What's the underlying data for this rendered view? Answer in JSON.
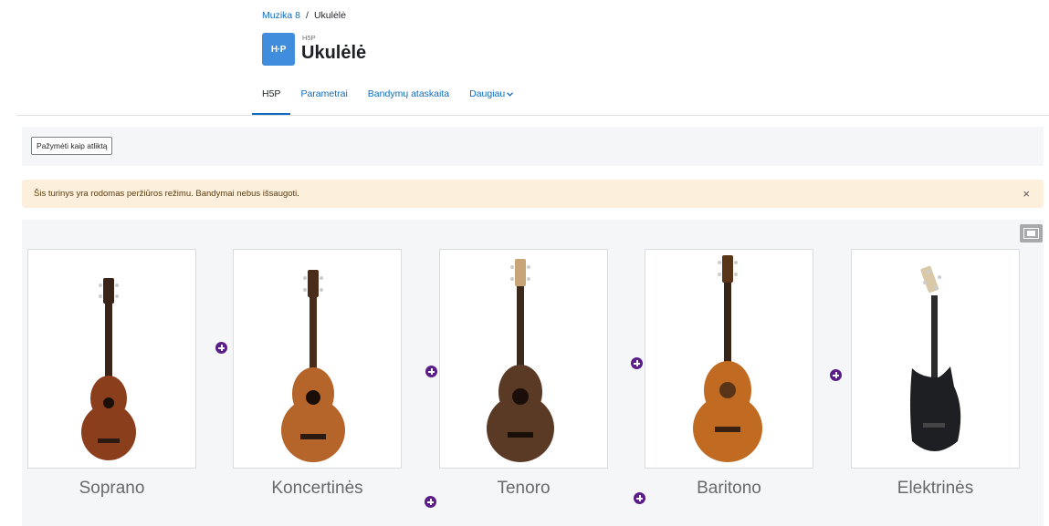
{
  "breadcrumb": {
    "course": "Muzika 8",
    "separator": "/",
    "current": "Ukulėlė"
  },
  "activity": {
    "logo_text": "H·P",
    "type_label": "H5P",
    "title": "Ukulėlė"
  },
  "nav": {
    "tabs": [
      {
        "label": "H5P",
        "active": true
      },
      {
        "label": "Parametrai",
        "active": false
      },
      {
        "label": "Bandymų ataskaita",
        "active": false
      },
      {
        "label": "Daugiau",
        "active": false,
        "has_dropdown": true
      }
    ],
    "dropdown_caret": "⌄"
  },
  "completion": {
    "button_label": "Pažymėti kaip atliktą"
  },
  "alert": {
    "text": "Šis turinys yra rodomas peržiūros režimu. Bandymai nebus išsaugoti.",
    "close_symbol": "×"
  },
  "h5p": {
    "fullscreen_icon": "fullscreen-icon",
    "items": [
      {
        "label": "Soprano",
        "body_color": "#8b3e1c",
        "neck_color": "#3a2418"
      },
      {
        "label": "Koncertinės",
        "body_color": "#b5652a",
        "neck_color": "#4a2c1a"
      },
      {
        "label": "Tenoro",
        "body_color": "#5a3a24",
        "neck_color": "#3b2a1c"
      },
      {
        "label": "Baritono",
        "body_color": "#c06a22",
        "neck_color": "#5a3418"
      },
      {
        "label": "Elektrinės",
        "body_color": "#1e1f23",
        "neck_color": "#2b2b2e"
      }
    ],
    "hotspot_color": "#5b1d8a",
    "hotspot_icon": "plus-icon"
  }
}
